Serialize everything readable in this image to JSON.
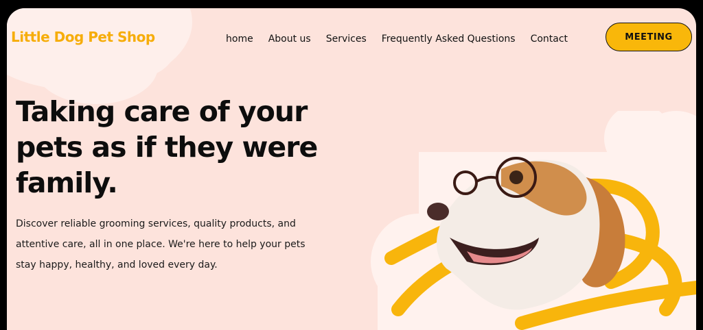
{
  "brand": {
    "name": "Little Dog Pet Shop"
  },
  "nav": {
    "items": [
      {
        "label": "home"
      },
      {
        "label": "About us"
      },
      {
        "label": "Services"
      },
      {
        "label": "Frequently Asked Questions"
      },
      {
        "label": "Contact"
      }
    ]
  },
  "cta": {
    "label": "MEETING"
  },
  "hero": {
    "title": "Taking care of your pets as if they were family.",
    "description": "Discover reliable grooming services, quality products, and attentive care, all in one place. We're here to help your pets stay happy, healthy, and loved every day."
  },
  "colors": {
    "background": "#fde3dc",
    "accent": "#f9b70a",
    "text": "#0d0d0d"
  },
  "illustration": {
    "icon": "dog-with-glasses-icon"
  }
}
